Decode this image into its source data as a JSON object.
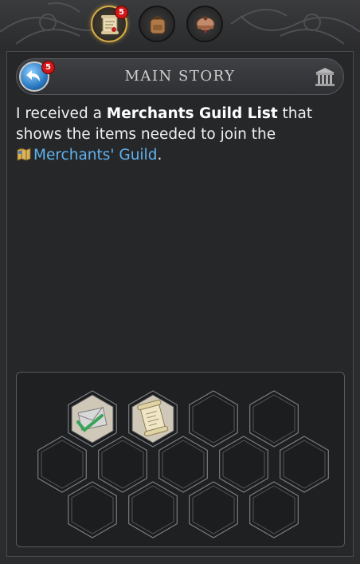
{
  "tabs": [
    {
      "name": "quest-scroll",
      "badge": "5",
      "active": true
    },
    {
      "name": "backpack",
      "active": false
    },
    {
      "name": "cooking-pot",
      "active": false
    }
  ],
  "header": {
    "back_badge": "5",
    "title": "MAIN STORY"
  },
  "story": {
    "part1": "I received a ",
    "item_name": "Merchants Guild List",
    "part2": " that shows the items needed to join the ",
    "link_text": "Merchants' Guild",
    "part3": "."
  },
  "inventory": {
    "slots": [
      {
        "item": "letter-checked",
        "filled": true
      },
      {
        "item": "parchment-scroll",
        "filled": true
      },
      {
        "item": "",
        "filled": false
      },
      {
        "item": "",
        "filled": false
      },
      {
        "item": "",
        "filled": false
      },
      {
        "item": "",
        "filled": false
      },
      {
        "item": "",
        "filled": false
      },
      {
        "item": "",
        "filled": false
      },
      {
        "item": "",
        "filled": false
      },
      {
        "item": "",
        "filled": false
      },
      {
        "item": "",
        "filled": false
      },
      {
        "item": "",
        "filled": false
      },
      {
        "item": "",
        "filled": false
      }
    ]
  },
  "colors": {
    "accent_gold": "#d8ad46",
    "badge_red": "#d11818",
    "link_blue": "#5fb2ef"
  }
}
